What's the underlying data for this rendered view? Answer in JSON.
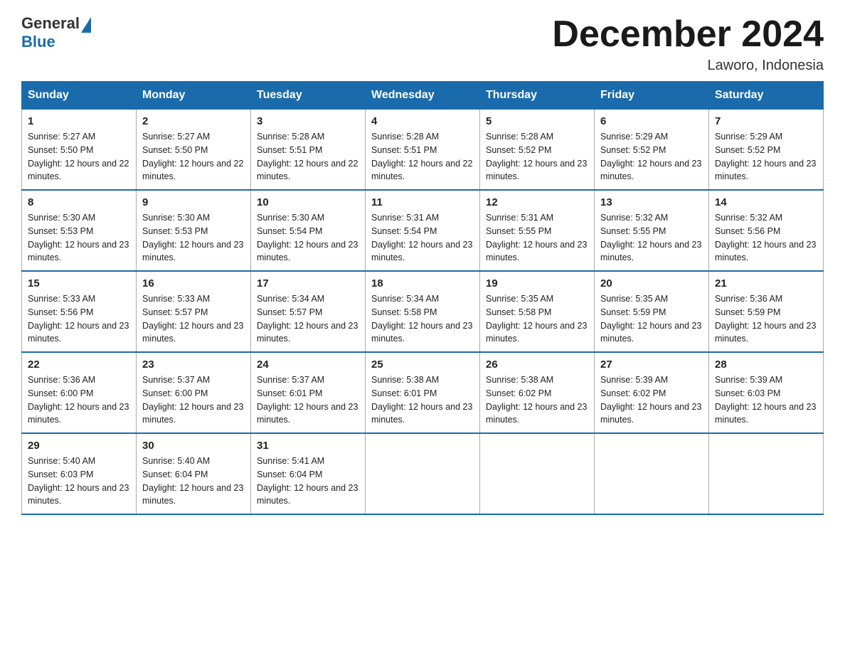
{
  "logo": {
    "general": "General",
    "blue": "Blue"
  },
  "title": "December 2024",
  "location": "Laworo, Indonesia",
  "days_header": [
    "Sunday",
    "Monday",
    "Tuesday",
    "Wednesday",
    "Thursday",
    "Friday",
    "Saturday"
  ],
  "weeks": [
    [
      {
        "day": "1",
        "sunrise": "5:27 AM",
        "sunset": "5:50 PM",
        "daylight": "12 hours and 22 minutes."
      },
      {
        "day": "2",
        "sunrise": "5:27 AM",
        "sunset": "5:50 PM",
        "daylight": "12 hours and 22 minutes."
      },
      {
        "day": "3",
        "sunrise": "5:28 AM",
        "sunset": "5:51 PM",
        "daylight": "12 hours and 22 minutes."
      },
      {
        "day": "4",
        "sunrise": "5:28 AM",
        "sunset": "5:51 PM",
        "daylight": "12 hours and 22 minutes."
      },
      {
        "day": "5",
        "sunrise": "5:28 AM",
        "sunset": "5:52 PM",
        "daylight": "12 hours and 23 minutes."
      },
      {
        "day": "6",
        "sunrise": "5:29 AM",
        "sunset": "5:52 PM",
        "daylight": "12 hours and 23 minutes."
      },
      {
        "day": "7",
        "sunrise": "5:29 AM",
        "sunset": "5:52 PM",
        "daylight": "12 hours and 23 minutes."
      }
    ],
    [
      {
        "day": "8",
        "sunrise": "5:30 AM",
        "sunset": "5:53 PM",
        "daylight": "12 hours and 23 minutes."
      },
      {
        "day": "9",
        "sunrise": "5:30 AM",
        "sunset": "5:53 PM",
        "daylight": "12 hours and 23 minutes."
      },
      {
        "day": "10",
        "sunrise": "5:30 AM",
        "sunset": "5:54 PM",
        "daylight": "12 hours and 23 minutes."
      },
      {
        "day": "11",
        "sunrise": "5:31 AM",
        "sunset": "5:54 PM",
        "daylight": "12 hours and 23 minutes."
      },
      {
        "day": "12",
        "sunrise": "5:31 AM",
        "sunset": "5:55 PM",
        "daylight": "12 hours and 23 minutes."
      },
      {
        "day": "13",
        "sunrise": "5:32 AM",
        "sunset": "5:55 PM",
        "daylight": "12 hours and 23 minutes."
      },
      {
        "day": "14",
        "sunrise": "5:32 AM",
        "sunset": "5:56 PM",
        "daylight": "12 hours and 23 minutes."
      }
    ],
    [
      {
        "day": "15",
        "sunrise": "5:33 AM",
        "sunset": "5:56 PM",
        "daylight": "12 hours and 23 minutes."
      },
      {
        "day": "16",
        "sunrise": "5:33 AM",
        "sunset": "5:57 PM",
        "daylight": "12 hours and 23 minutes."
      },
      {
        "day": "17",
        "sunrise": "5:34 AM",
        "sunset": "5:57 PM",
        "daylight": "12 hours and 23 minutes."
      },
      {
        "day": "18",
        "sunrise": "5:34 AM",
        "sunset": "5:58 PM",
        "daylight": "12 hours and 23 minutes."
      },
      {
        "day": "19",
        "sunrise": "5:35 AM",
        "sunset": "5:58 PM",
        "daylight": "12 hours and 23 minutes."
      },
      {
        "day": "20",
        "sunrise": "5:35 AM",
        "sunset": "5:59 PM",
        "daylight": "12 hours and 23 minutes."
      },
      {
        "day": "21",
        "sunrise": "5:36 AM",
        "sunset": "5:59 PM",
        "daylight": "12 hours and 23 minutes."
      }
    ],
    [
      {
        "day": "22",
        "sunrise": "5:36 AM",
        "sunset": "6:00 PM",
        "daylight": "12 hours and 23 minutes."
      },
      {
        "day": "23",
        "sunrise": "5:37 AM",
        "sunset": "6:00 PM",
        "daylight": "12 hours and 23 minutes."
      },
      {
        "day": "24",
        "sunrise": "5:37 AM",
        "sunset": "6:01 PM",
        "daylight": "12 hours and 23 minutes."
      },
      {
        "day": "25",
        "sunrise": "5:38 AM",
        "sunset": "6:01 PM",
        "daylight": "12 hours and 23 minutes."
      },
      {
        "day": "26",
        "sunrise": "5:38 AM",
        "sunset": "6:02 PM",
        "daylight": "12 hours and 23 minutes."
      },
      {
        "day": "27",
        "sunrise": "5:39 AM",
        "sunset": "6:02 PM",
        "daylight": "12 hours and 23 minutes."
      },
      {
        "day": "28",
        "sunrise": "5:39 AM",
        "sunset": "6:03 PM",
        "daylight": "12 hours and 23 minutes."
      }
    ],
    [
      {
        "day": "29",
        "sunrise": "5:40 AM",
        "sunset": "6:03 PM",
        "daylight": "12 hours and 23 minutes."
      },
      {
        "day": "30",
        "sunrise": "5:40 AM",
        "sunset": "6:04 PM",
        "daylight": "12 hours and 23 minutes."
      },
      {
        "day": "31",
        "sunrise": "5:41 AM",
        "sunset": "6:04 PM",
        "daylight": "12 hours and 23 minutes."
      },
      null,
      null,
      null,
      null
    ]
  ]
}
